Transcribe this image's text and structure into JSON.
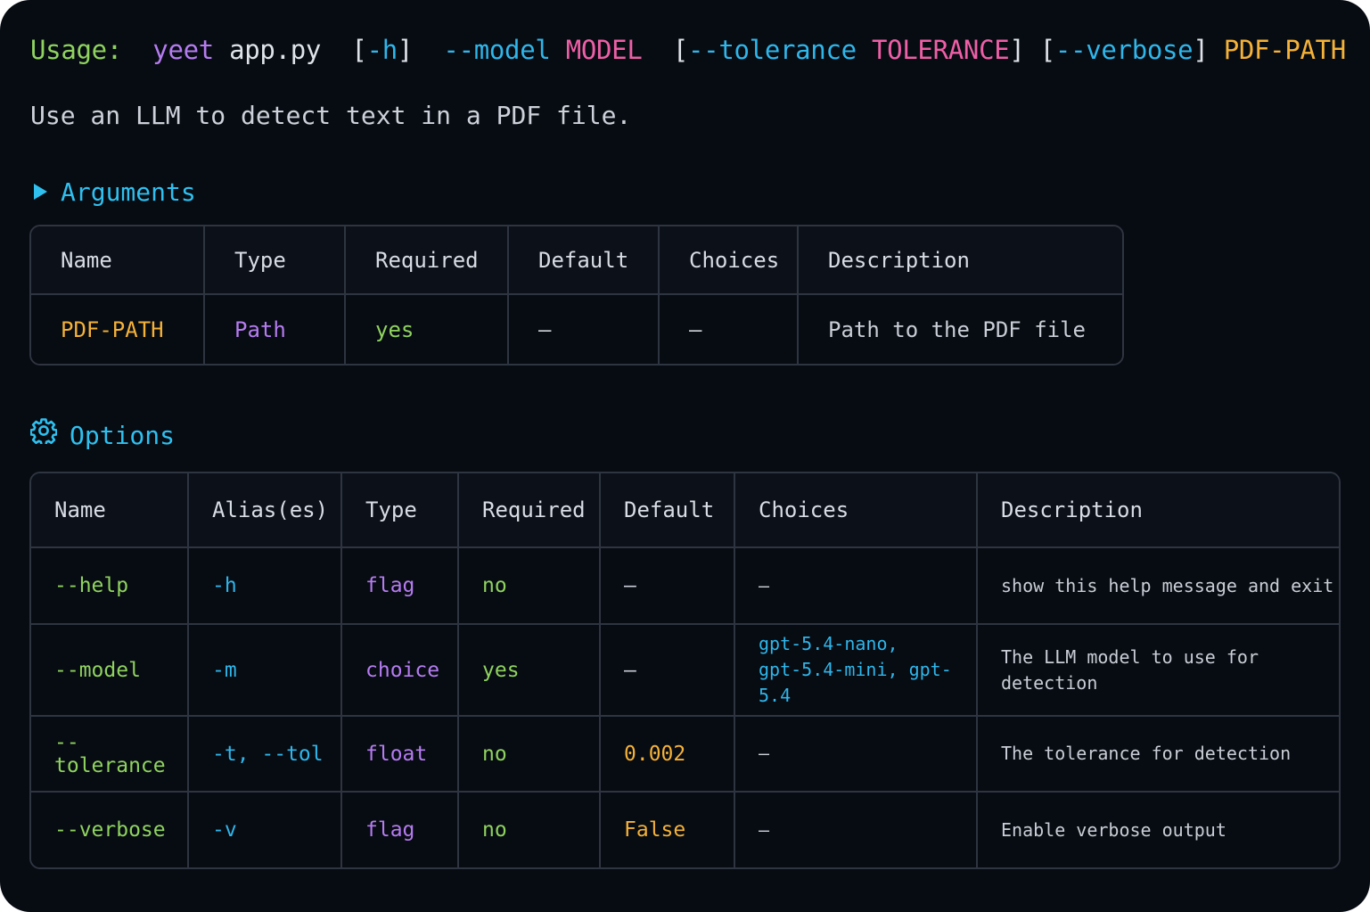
{
  "usage": {
    "label": "Usage:",
    "cmd": "yeet",
    "script": "app.py",
    "help_open": "[",
    "help_flag": "-h",
    "help_close": "]",
    "model_flag": "--model",
    "model_meta": "MODEL",
    "tol_open": "[",
    "tol_flag": "--tolerance",
    "tol_meta": "TOLERANCE",
    "tol_close": "]",
    "verbose_open": "[",
    "verbose_flag": "--verbose",
    "verbose_close": "]",
    "positional": "PDF-PATH"
  },
  "description": "Use an LLM to detect text in a PDF file.",
  "arguments": {
    "title": "Arguments",
    "icon": "triangle-right-icon",
    "headers": [
      "Name",
      "Type",
      "Required",
      "Default",
      "Choices",
      "Description"
    ],
    "rows": [
      {
        "name": "PDF-PATH",
        "type": "Path",
        "required": "yes",
        "default": "–",
        "choices": "–",
        "description": "Path to the PDF file"
      }
    ]
  },
  "options": {
    "title": "Options",
    "icon": "gear-icon",
    "headers": [
      "Name",
      "Alias(es)",
      "Type",
      "Required",
      "Default",
      "Choices",
      "Description"
    ],
    "rows": [
      {
        "name": "--help",
        "aliases": "-h",
        "type": "flag",
        "required": "no",
        "default": "–",
        "choices_line1": "–",
        "choices_line2": "",
        "description": "show this help message and exit"
      },
      {
        "name": "--model",
        "aliases": "-m",
        "type": "choice",
        "required": "yes",
        "default": "–",
        "choices_line1": "gpt-5.4-nano,",
        "choices_line2": "gpt-5.4-mini, gpt-5.4",
        "description": "The LLM model to use for detection"
      },
      {
        "name": "--tolerance",
        "aliases": "-t, --tol",
        "type": "float",
        "required": "no",
        "default": "0.002",
        "choices_line1": "–",
        "choices_line2": "",
        "description": "The tolerance for detection"
      },
      {
        "name": "--verbose",
        "aliases": "-v",
        "type": "flag",
        "required": "no",
        "default": "False",
        "choices_line1": "–",
        "choices_line2": "",
        "description": "Enable verbose output"
      }
    ]
  },
  "colors": {
    "background": "#070b12",
    "border": "#2f3540",
    "green": "#8fd35f",
    "purple": "#b57cf0",
    "blue": "#2fb6ea",
    "pink": "#ee5fa6",
    "orange": "#f5b238"
  }
}
